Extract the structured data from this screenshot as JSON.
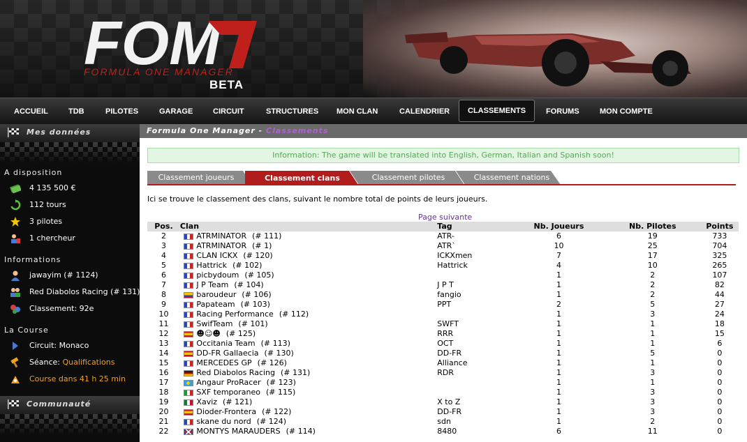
{
  "header": {
    "logo_text": "FOM",
    "logo_subtitle": "FORMULA ONE MANAGER",
    "beta": "BETA"
  },
  "nav": [
    "ACCUEIL",
    "TDB",
    "PILOTES",
    "GARAGE",
    "CIRCUIT",
    "STRUCTURES",
    "MON CLAN",
    "CALENDRIER",
    "CLASSEMENTS",
    "FORUMS",
    "MON COMPTE"
  ],
  "nav_active": "CLASSEMENTS",
  "sidebar": {
    "mes_donnees": "Mes données",
    "a_disposition": "A disposition",
    "money": "4 135 500 €",
    "tours": "112 tours",
    "pilotes": "3 pilotes",
    "chercheur": "1 chercheur",
    "informations": "Informations",
    "user": "jawayim (# 1124)",
    "team": "Red Diabolos Racing (# 131)",
    "classement": "Classement: 92e",
    "la_course": "La Course",
    "circuit": "Circuit: Monaco",
    "seance_label": "Séance: ",
    "seance_value": "Qualifications",
    "course": "Course dans 41 h 25 min",
    "communaute": "Communauté"
  },
  "main": {
    "crumb": "Formula One Manager",
    "crumb_sep": " - ",
    "crumb_page": "Classements",
    "info": "Information: The game will be translated into English, German, Italian and Spanish soon!",
    "tabs": [
      "Classement joueurs",
      "Classement clans",
      "Classement pilotes",
      "Classement nations"
    ],
    "active_tab": 1,
    "intro": "Ici se trouve le classement des clans, suivant le nombre total de points de leurs joueurs.",
    "next_page": "Page suivante"
  },
  "table": {
    "headers": {
      "pos": "Pos.",
      "clan": "Clan",
      "tag": "Tag",
      "nj": "Nb. Joueurs",
      "np": "Nb. Pilotes",
      "pts": "Points"
    },
    "rows": [
      {
        "pos": "2",
        "flag": "fr",
        "clan": "ATRMINATOR",
        "num": "(# 111)",
        "tag": "ATR-",
        "nj": "6",
        "np": "19",
        "pts": "733"
      },
      {
        "pos": "3",
        "flag": "fr",
        "clan": "ATRMINATOR",
        "num": "(# 1)",
        "tag": "ATR`",
        "nj": "10",
        "np": "25",
        "pts": "704"
      },
      {
        "pos": "4",
        "flag": "fr",
        "clan": "CLAN ICKX",
        "num": "(# 120)",
        "tag": "ICKXmen",
        "nj": "7",
        "np": "17",
        "pts": "325"
      },
      {
        "pos": "5",
        "flag": "fr",
        "clan": "Hattrick",
        "num": "(# 102)",
        "tag": "Hattrick",
        "nj": "4",
        "np": "10",
        "pts": "265"
      },
      {
        "pos": "6",
        "flag": "fr",
        "clan": "picbydoum",
        "num": "(# 105)",
        "tag": "",
        "nj": "1",
        "np": "2",
        "pts": "107"
      },
      {
        "pos": "7",
        "flag": "fr",
        "clan": "J P Team",
        "num": "(# 104)",
        "tag": "J P T",
        "nj": "1",
        "np": "2",
        "pts": "82"
      },
      {
        "pos": "8",
        "flag": "co",
        "clan": "baroudeur",
        "num": "(# 106)",
        "tag": "fangio",
        "nj": "1",
        "np": "2",
        "pts": "44"
      },
      {
        "pos": "9",
        "flag": "fr",
        "clan": "Papateam",
        "num": "(# 103)",
        "tag": "PPT",
        "nj": "2",
        "np": "5",
        "pts": "27"
      },
      {
        "pos": "10",
        "flag": "fr",
        "clan": "Racing Performance",
        "num": "(# 112)",
        "tag": "",
        "nj": "1",
        "np": "3",
        "pts": "24"
      },
      {
        "pos": "11",
        "flag": "fr",
        "clan": "SwifTeam",
        "num": "(# 101)",
        "tag": "SWFT",
        "nj": "1",
        "np": "1",
        "pts": "18"
      },
      {
        "pos": "12",
        "flag": "es",
        "clan": "☻☺☻",
        "num": "(# 125)",
        "tag": "RRR",
        "nj": "1",
        "np": "1",
        "pts": "15"
      },
      {
        "pos": "13",
        "flag": "fr",
        "clan": "Occitania Team",
        "num": "(# 113)",
        "tag": "OCT",
        "nj": "1",
        "np": "1",
        "pts": "6"
      },
      {
        "pos": "14",
        "flag": "es",
        "clan": "DD-FR Gallaecia",
        "num": "(# 130)",
        "tag": "DD-FR",
        "nj": "1",
        "np": "5",
        "pts": "0"
      },
      {
        "pos": "15",
        "flag": "fr",
        "clan": "MERCEDES GP",
        "num": "(# 126)",
        "tag": "Alliance",
        "nj": "1",
        "np": "1",
        "pts": "0"
      },
      {
        "pos": "16",
        "flag": "de",
        "clan": "Red Diabolos Racing",
        "num": "(# 131)",
        "tag": "RDR",
        "nj": "1",
        "np": "3",
        "pts": "0"
      },
      {
        "pos": "17",
        "flag": "pw",
        "clan": "Angaur ProRacer",
        "num": "(# 123)",
        "tag": "",
        "nj": "1",
        "np": "1",
        "pts": "0"
      },
      {
        "pos": "18",
        "flag": "it",
        "clan": "SXF temporaneo",
        "num": "(# 115)",
        "tag": "",
        "nj": "1",
        "np": "3",
        "pts": "0"
      },
      {
        "pos": "19",
        "flag": "mx",
        "clan": "Xaviz",
        "num": "(# 121)",
        "tag": "X to Z",
        "nj": "1",
        "np": "3",
        "pts": "0"
      },
      {
        "pos": "20",
        "flag": "es",
        "clan": "Dioder-Frontera",
        "num": "(# 122)",
        "tag": "DD-FR",
        "nj": "1",
        "np": "3",
        "pts": "0"
      },
      {
        "pos": "21",
        "flag": "fr",
        "clan": "skane du nord",
        "num": "(# 124)",
        "tag": "sdn",
        "nj": "1",
        "np": "2",
        "pts": "0"
      },
      {
        "pos": "22",
        "flag": "gb",
        "clan": "MONTYS MARAUDERS",
        "num": "(# 114)",
        "tag": "8480",
        "nj": "6",
        "np": "11",
        "pts": "0"
      }
    ]
  },
  "colors": {
    "accent": "#b11d1d",
    "nav_bg": "#1a1a1a",
    "sidebar_bg": "#0c0c0c",
    "info_text": "#55aa55",
    "link": "#663399"
  }
}
